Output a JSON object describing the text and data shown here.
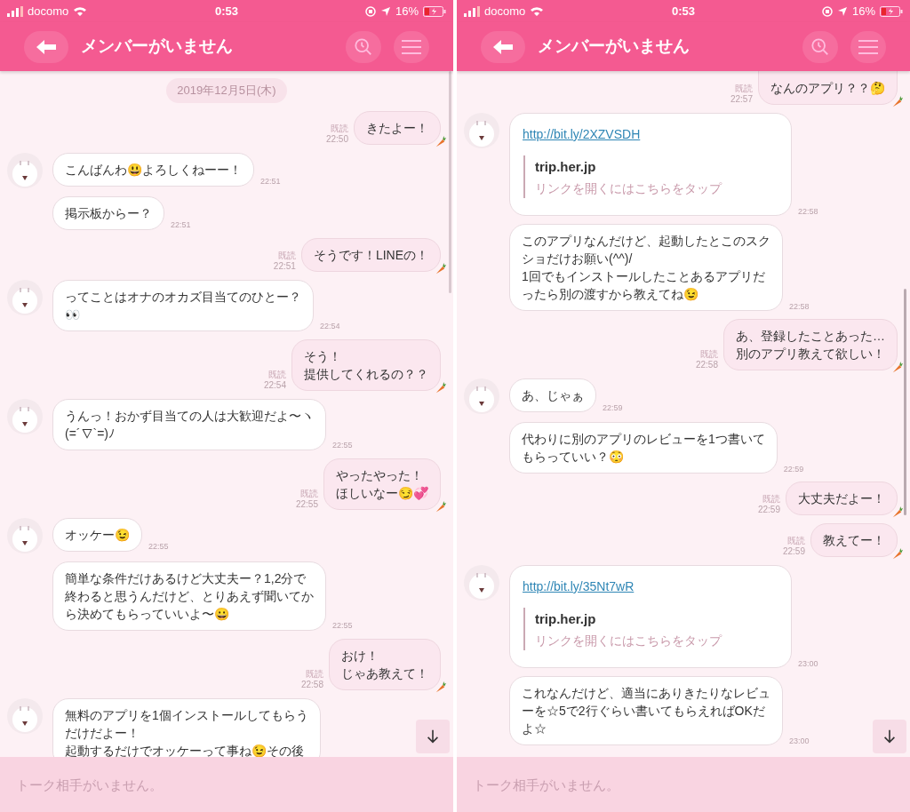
{
  "screens": [
    {
      "status_bar": {
        "carrier": "docomo",
        "time": "0:53",
        "battery": "16%"
      },
      "header": {
        "title": "メンバーがいません"
      },
      "messages": [
        {
          "kind": "date",
          "text": "2019年12月5日(木)"
        },
        {
          "kind": "text",
          "outgoing": true,
          "lines": [
            "きたよー！"
          ],
          "read": "既読",
          "time": "22:50"
        },
        {
          "kind": "text",
          "outgoing": false,
          "avatar": true,
          "lines": [
            "こんばんわ😃よろしくねーー！"
          ],
          "time": "22:51"
        },
        {
          "kind": "text",
          "outgoing": false,
          "avatar": false,
          "lines": [
            "掲示板からー？"
          ],
          "time": "22:51"
        },
        {
          "kind": "text",
          "outgoing": true,
          "lines": [
            "そうです！LINEの！"
          ],
          "read": "既読",
          "time": "22:51"
        },
        {
          "kind": "text",
          "outgoing": false,
          "avatar": true,
          "lines": [
            "ってことはオナのオカズ目当てのひとー？",
            "👀"
          ],
          "time": "22:54"
        },
        {
          "kind": "text",
          "outgoing": true,
          "lines": [
            "そう！",
            "提供してくれるの？？"
          ],
          "read": "既読",
          "time": "22:54"
        },
        {
          "kind": "text",
          "outgoing": false,
          "avatar": true,
          "lines": [
            "うんっ！おかず目当ての人は大歓迎だよ〜ヽ",
            "(=´∇`=)ﾉ"
          ],
          "time": "22:55"
        },
        {
          "kind": "text",
          "outgoing": true,
          "lines": [
            "やったやった！",
            "ほしいなー😏💞"
          ],
          "read": "既読",
          "time": "22:55"
        },
        {
          "kind": "text",
          "outgoing": false,
          "avatar": true,
          "lines": [
            "オッケー😉"
          ],
          "time": "22:55"
        },
        {
          "kind": "text",
          "outgoing": false,
          "avatar": false,
          "lines": [
            "簡単な条件だけあるけど大丈夫ー？1,2分で",
            "終わると思うんだけど、とりあえず聞いてか",
            "ら決めてもらっていいよ〜😀"
          ],
          "time": "22:55"
        },
        {
          "kind": "text",
          "outgoing": true,
          "lines": [
            "おけ！",
            "じゃあ教えて！"
          ],
          "read": "既読",
          "time": "22:58"
        },
        {
          "kind": "text",
          "outgoing": false,
          "avatar": true,
          "lines": [
            "無料のアプリを1個インストールしてもらう",
            "だけだよー！",
            "起動するだけでオッケーって事ね😉その後"
          ]
        }
      ],
      "input": {
        "placeholder": "トーク相手がいません。"
      }
    },
    {
      "status_bar": {
        "carrier": "docomo",
        "time": "0:53",
        "battery": "16%"
      },
      "header": {
        "title": "メンバーがいません"
      },
      "messages": [
        {
          "kind": "text",
          "outgoing": true,
          "cut_top": true,
          "lines": [
            "なんのアプリ？？🤔"
          ],
          "read": "既読",
          "time": "22:57"
        },
        {
          "kind": "link",
          "outgoing": false,
          "avatar": true,
          "url": "http://bit.ly/2XZVSDH",
          "site": "trip.her.jp",
          "hint": "リンクを開くにはこちらをタップ",
          "time": "22:58"
        },
        {
          "kind": "text",
          "outgoing": false,
          "avatar": false,
          "lines": [
            "このアプリなんだけど、起動したとこのスク",
            "ショだけお願い(^^)/",
            "1回でもインストールしたことあるアプリだ",
            "ったら別の渡すから教えてね😉"
          ],
          "time": "22:58"
        },
        {
          "kind": "text",
          "outgoing": true,
          "lines": [
            "あ、登録したことあった…",
            "別のアプリ教えて欲しい！"
          ],
          "read": "既読",
          "time": "22:58"
        },
        {
          "kind": "text",
          "outgoing": false,
          "avatar": true,
          "lines": [
            "あ、じゃぁ"
          ],
          "time": "22:59"
        },
        {
          "kind": "text",
          "outgoing": false,
          "avatar": false,
          "lines": [
            "代わりに別のアプリのレビューを1つ書いて",
            "もらっていい？😳"
          ],
          "time": "22:59"
        },
        {
          "kind": "text",
          "outgoing": true,
          "lines": [
            "大丈夫だよー！"
          ],
          "read": "既読",
          "time": "22:59"
        },
        {
          "kind": "text",
          "outgoing": true,
          "lines": [
            "教えてー！"
          ],
          "read": "既読",
          "time": "22:59"
        },
        {
          "kind": "link",
          "outgoing": false,
          "avatar": true,
          "url": "http://bit.ly/35Nt7wR",
          "site": "trip.her.jp",
          "hint": "リンクを開くにはこちらをタップ",
          "time": "23:00"
        },
        {
          "kind": "text",
          "outgoing": false,
          "avatar": false,
          "lines": [
            "これなんだけど、適当にありきたりなレビュ",
            "ーを☆5で2行ぐらい書いてもらえればOKだ",
            "よ☆"
          ],
          "time": "23:00"
        }
      ],
      "input": {
        "placeholder": "トーク相手がいません。"
      }
    }
  ]
}
